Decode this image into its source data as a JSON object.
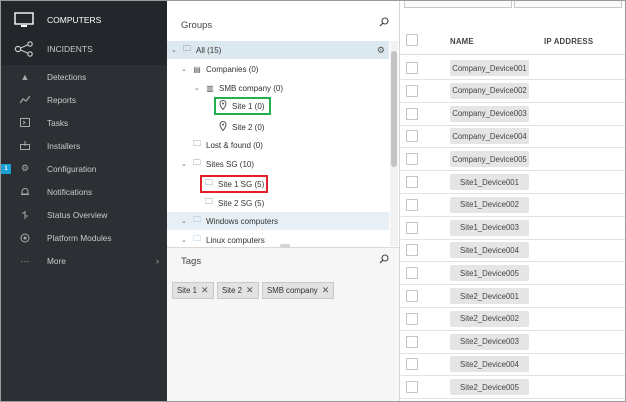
{
  "nav": {
    "computers_label": "COMPUTERS",
    "incidents_label": "INCIDENTS",
    "items": [
      {
        "label": "Detections",
        "icon": "warning-icon"
      },
      {
        "label": "Reports",
        "icon": "chart-icon"
      },
      {
        "label": "Tasks",
        "icon": "tasks-icon"
      },
      {
        "label": "Installers",
        "icon": "installer-icon"
      },
      {
        "label": "Configuration",
        "icon": "gear-icon",
        "badge": "1"
      },
      {
        "label": "Notifications",
        "icon": "bell-icon"
      },
      {
        "label": "Status Overview",
        "icon": "status-icon"
      },
      {
        "label": "Platform Modules",
        "icon": "module-icon"
      },
      {
        "label": "More",
        "icon": "ellipsis-icon"
      }
    ]
  },
  "groups": {
    "title": "Groups",
    "tree": {
      "all": "All (15)",
      "companies": "Companies (0)",
      "smb_company": "SMB company (0)",
      "site1": "Site 1 (0)",
      "site2": "Site 2 (0)",
      "lost_found": "Lost & found (0)",
      "sites_sg": "Sites SG (10)",
      "site1_sg": "Site 1 SG (5)",
      "site2_sg": "Site 2 SG (5)",
      "windows": "Windows computers",
      "linux": "Linux computers"
    }
  },
  "tags": {
    "title": "Tags",
    "items": [
      "Site 1",
      "Site 2",
      "SMB company"
    ]
  },
  "table": {
    "col_name": "NAME",
    "col_ip": "IP ADDRESS",
    "rows": [
      "Company_Device001",
      "Company_Device002",
      "Company_Device003",
      "Company_Device004",
      "Company_Device005",
      "Site1_Device001",
      "Site1_Device002",
      "Site1_Device003",
      "Site1_Device004",
      "Site1_Device005",
      "Site2_Device001",
      "Site2_Device002",
      "Site2_Device003",
      "Site2_Device004",
      "Site2_Device005"
    ]
  },
  "colors": {
    "nav_bg": "#2c2f33",
    "badge": "#1a9fd4",
    "highlight_green": "#22b14c",
    "highlight_red": "#e0202a",
    "selected_row": "#dbe8ef"
  }
}
